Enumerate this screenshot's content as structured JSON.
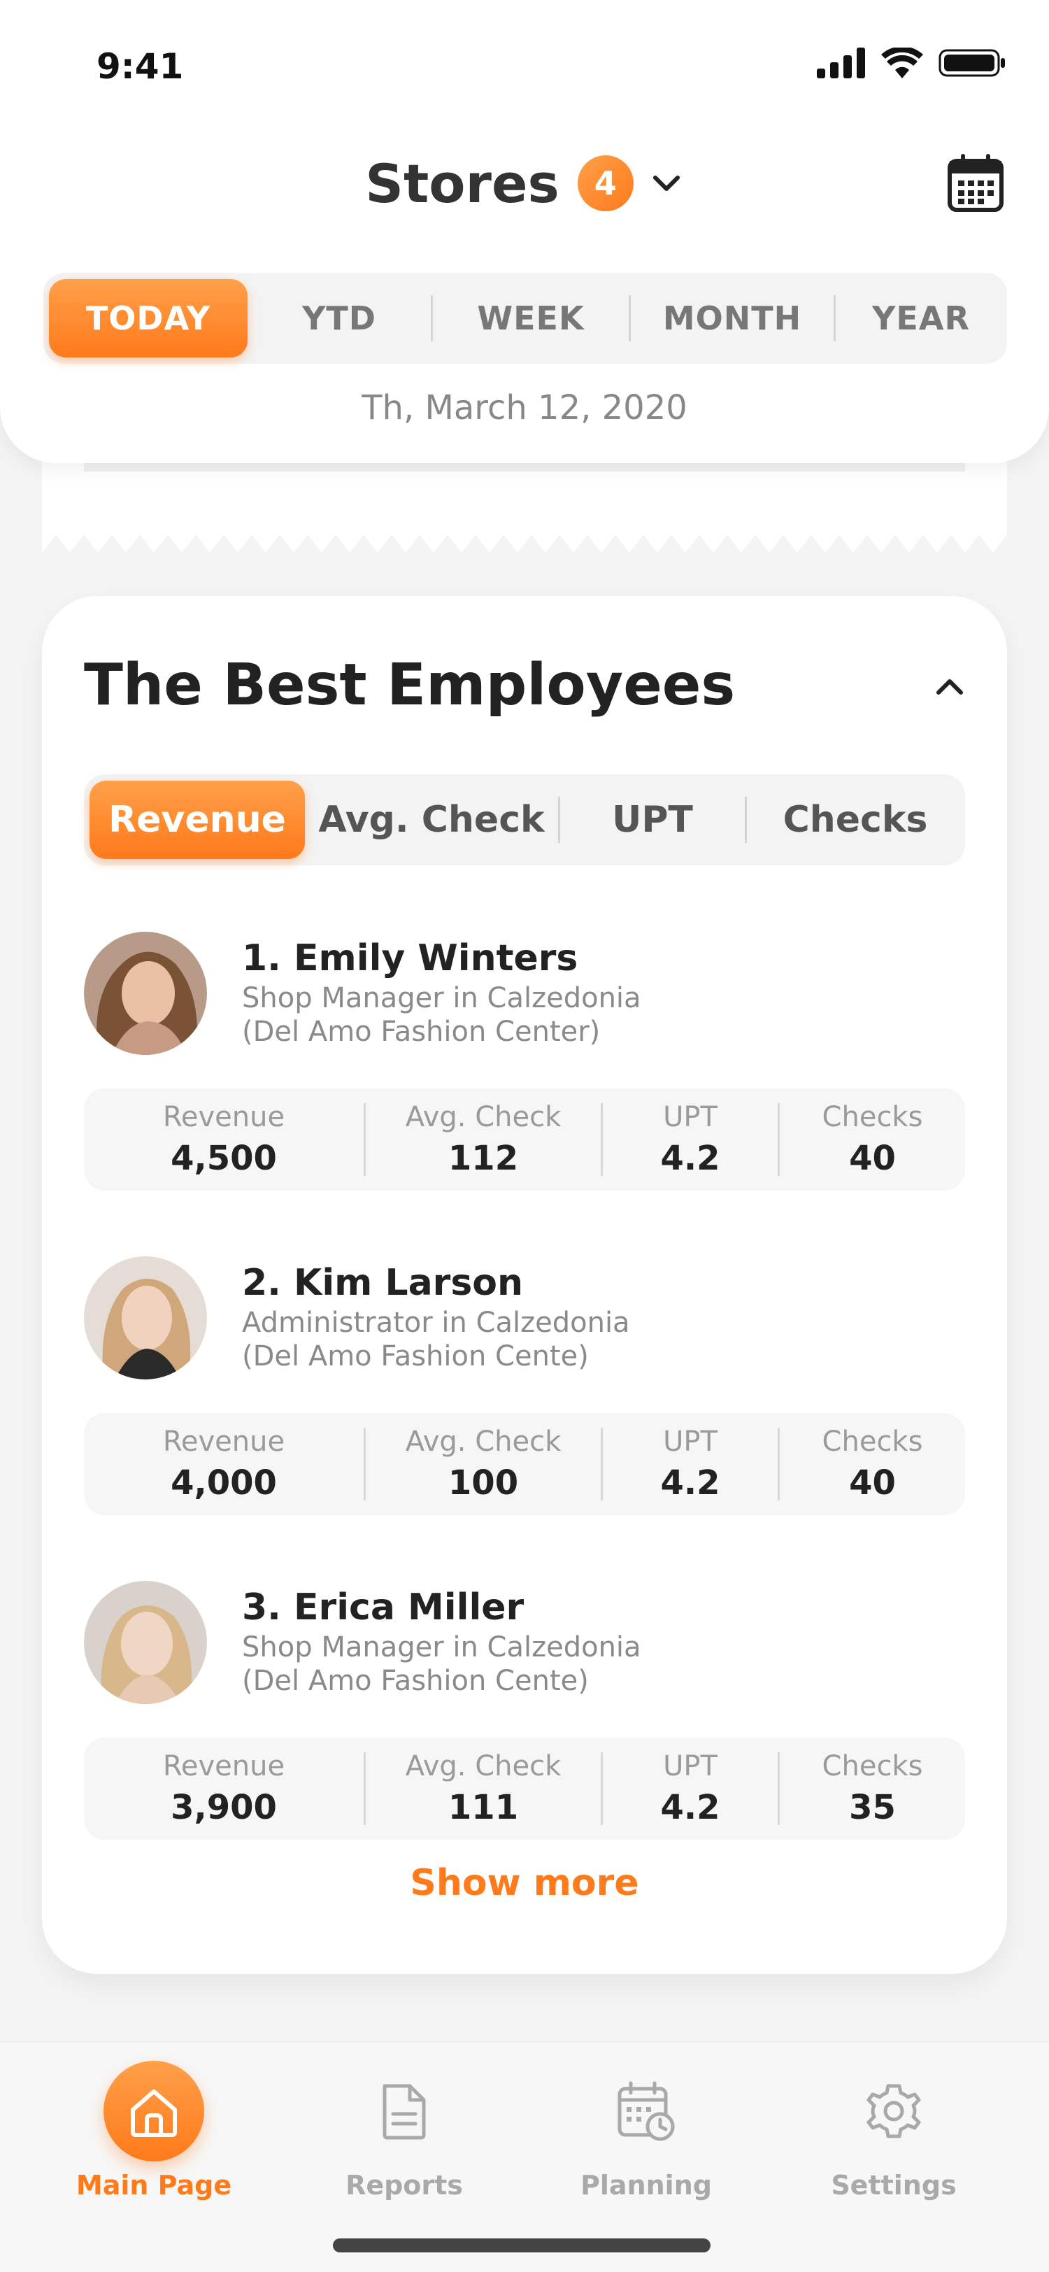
{
  "status": {
    "time": "9:41"
  },
  "header": {
    "title": "Stores",
    "badge_count": "4",
    "periods": [
      "TODAY",
      "YTD",
      "WEEK",
      "MONTH",
      "YEAR"
    ],
    "active_period": "TODAY",
    "date": "Th, March 12, 2020"
  },
  "best_employees": {
    "title": "The Best Employees",
    "metrics": [
      "Revenue",
      "Avg. Check",
      "UPT",
      "Checks"
    ],
    "active_metric": "Revenue",
    "employees": [
      {
        "name": "1. Emily Winters",
        "role": "Shop Manager in Calzedonia",
        "location": "(Del Amo Fashion Center)",
        "stats": [
          {
            "label": "Revenue",
            "value": "4,500"
          },
          {
            "label": "Avg. Check",
            "value": "112"
          },
          {
            "label": "UPT",
            "value": "4.2"
          },
          {
            "label": "Checks",
            "value": "40"
          }
        ]
      },
      {
        "name": "2. Kim Larson",
        "role": "Administrator in Calzedonia",
        "location": "(Del Amo Fashion Cente)",
        "stats": [
          {
            "label": "Revenue",
            "value": "4,000"
          },
          {
            "label": "Avg. Check",
            "value": "100"
          },
          {
            "label": "UPT",
            "value": "4.2"
          },
          {
            "label": "Checks",
            "value": "40"
          }
        ]
      },
      {
        "name": "3. Erica Miller",
        "role": "Shop Manager in Calzedonia",
        "location": "(Del Amo Fashion Cente)",
        "stats": [
          {
            "label": "Revenue",
            "value": "3,900"
          },
          {
            "label": "Avg. Check",
            "value": "111"
          },
          {
            "label": "UPT",
            "value": "4.2"
          },
          {
            "label": "Checks",
            "value": "35"
          }
        ]
      }
    ],
    "show_more": "Show more"
  },
  "tabbar": {
    "items": [
      {
        "label": "Main Page",
        "icon": "home-icon",
        "active": true
      },
      {
        "label": "Reports",
        "icon": "document-icon",
        "active": false
      },
      {
        "label": "Planning",
        "icon": "calendar-clock-icon",
        "active": false
      },
      {
        "label": "Settings",
        "icon": "gear-icon",
        "active": false
      }
    ]
  },
  "colors": {
    "accent": "#ff7a1a",
    "accent_light": "#ffa04a",
    "background": "#f4f4f4"
  }
}
